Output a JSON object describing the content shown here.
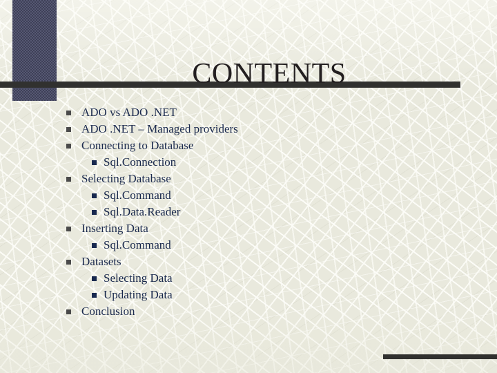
{
  "slide": {
    "title": "CONTENTS",
    "background_color": "#e9e9dd",
    "accent_color": "#31312f",
    "band_color": "#4b4d63",
    "text_color": "#1b2a4e",
    "title_color": "#231f20"
  },
  "bullets": [
    {
      "level": 1,
      "text": "ADO vs ADO .NET"
    },
    {
      "level": 1,
      "text": "ADO .NET – Managed providers"
    },
    {
      "level": 1,
      "text": "Connecting to Database"
    },
    {
      "level": 2,
      "text": "Sql.Connection"
    },
    {
      "level": 1,
      "text": "Selecting Database"
    },
    {
      "level": 2,
      "text": "Sql.Command"
    },
    {
      "level": 2,
      "text": "Sql.Data.Reader"
    },
    {
      "level": 1,
      "text": "Inserting Data"
    },
    {
      "level": 2,
      "text": "Sql.Command"
    },
    {
      "level": 1,
      "text": "Datasets"
    },
    {
      "level": 2,
      "text": "Selecting Data"
    },
    {
      "level": 2,
      "text": "Updating Data"
    },
    {
      "level": 1,
      "text": "Conclusion"
    }
  ]
}
